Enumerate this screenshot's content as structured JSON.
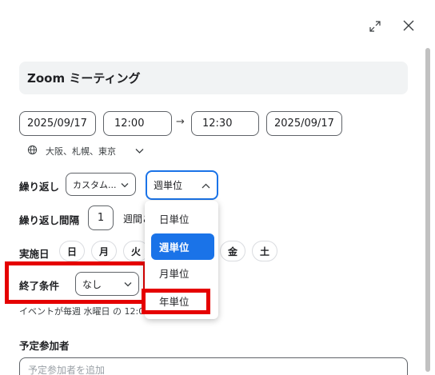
{
  "title": "Zoom ミーティング",
  "start_date": "2025/09/17",
  "start_time": "12:00",
  "end_time": "12:30",
  "end_date": "2025/09/17",
  "arrow": "→",
  "timezone": "大阪、札幌、東京",
  "repeat": {
    "label": "繰り返し",
    "type_value": "カスタム...",
    "unit_value": "週単位"
  },
  "interval": {
    "label": "繰り返し間隔",
    "value": "1",
    "suffix": "週間ご"
  },
  "days": {
    "label": "実施日",
    "items": [
      "日",
      "月",
      "火",
      "金",
      "土"
    ]
  },
  "end_condition": {
    "label": "終了条件",
    "value": "なし"
  },
  "summary": "イベントが毎週 水曜日 の 12:00",
  "dropdown": {
    "options": [
      "日単位",
      "週単位",
      "月単位",
      "年単位"
    ],
    "selected": "週単位"
  },
  "attendees": {
    "label": "予定参加者",
    "placeholder": "予定参加者を追加"
  },
  "colors": {
    "accent": "#1a73e8",
    "highlight": "#e50000"
  }
}
